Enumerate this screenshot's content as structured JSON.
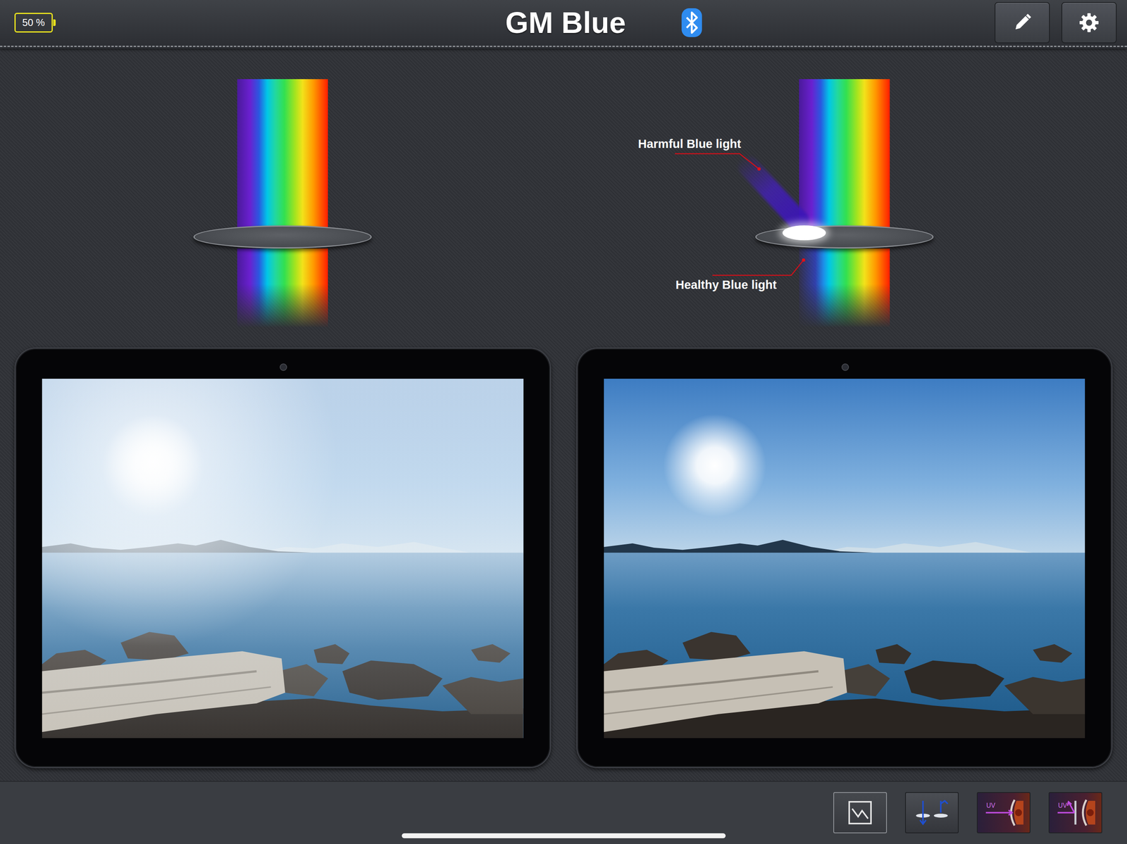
{
  "status": {
    "battery": "50 %"
  },
  "header": {
    "title": "GM Blue",
    "bluetooth": {
      "on": true
    },
    "actions": [
      {
        "kind": "edit"
      },
      {
        "kind": "settings"
      }
    ]
  },
  "panels": [
    {
      "filter": false,
      "labels": []
    },
    {
      "filter": true,
      "labels": [
        {
          "kind": "harmful",
          "text": "Harmful Blue light"
        },
        {
          "kind": "healthy",
          "text": "Healthy Blue light"
        }
      ]
    }
  ],
  "toolbar": [
    {
      "kind": "graph"
    },
    {
      "kind": "lens"
    },
    {
      "kind": "uv-pass",
      "label": "UV"
    },
    {
      "kind": "uv-block",
      "label": "UV"
    }
  ]
}
